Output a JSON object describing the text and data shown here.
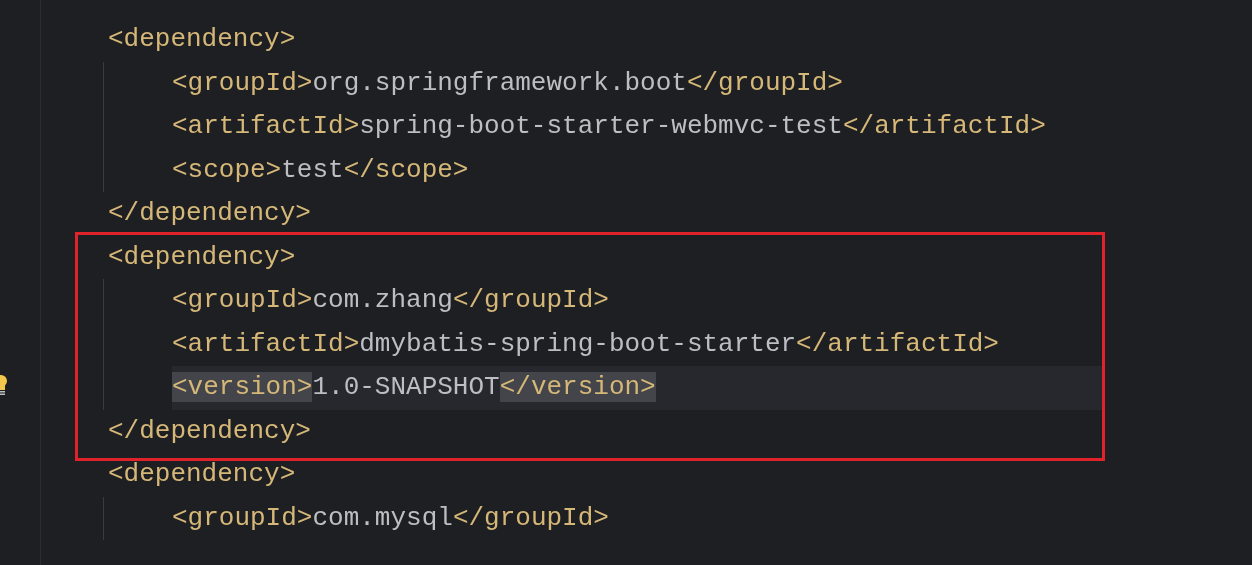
{
  "editor": {
    "blocks": [
      {
        "open": "<dependency>",
        "close": "</dependency>",
        "outlined": false,
        "children": [
          {
            "tag_open": "<groupId>",
            "value": "org.springframework.boot",
            "tag_close": "</groupId>",
            "current": false
          },
          {
            "tag_open": "<artifactId>",
            "value": "spring-boot-starter-webmvc-test",
            "tag_close": "</artifactId>",
            "current": false
          },
          {
            "tag_open": "<scope>",
            "value": "test",
            "tag_close": "</scope>",
            "current": false
          }
        ]
      },
      {
        "open": "<dependency>",
        "close": "</dependency>",
        "outlined": true,
        "children": [
          {
            "tag_open": "<groupId>",
            "value": "com.zhang",
            "tag_close": "</groupId>",
            "current": false
          },
          {
            "tag_open": "<artifactId>",
            "value": "dmybatis-spring-boot-starter",
            "tag_close": "</artifactId>",
            "current": false
          },
          {
            "tag_open": "<version>",
            "value": "1.0-SNAPSHOT",
            "tag_close": "</version>",
            "current": true
          }
        ]
      },
      {
        "open": "<dependency>",
        "outlined": false,
        "children": [
          {
            "tag_open": "<groupId>",
            "value": "com.mysql",
            "tag_close": "</groupId>",
            "current": false
          }
        ]
      }
    ]
  }
}
